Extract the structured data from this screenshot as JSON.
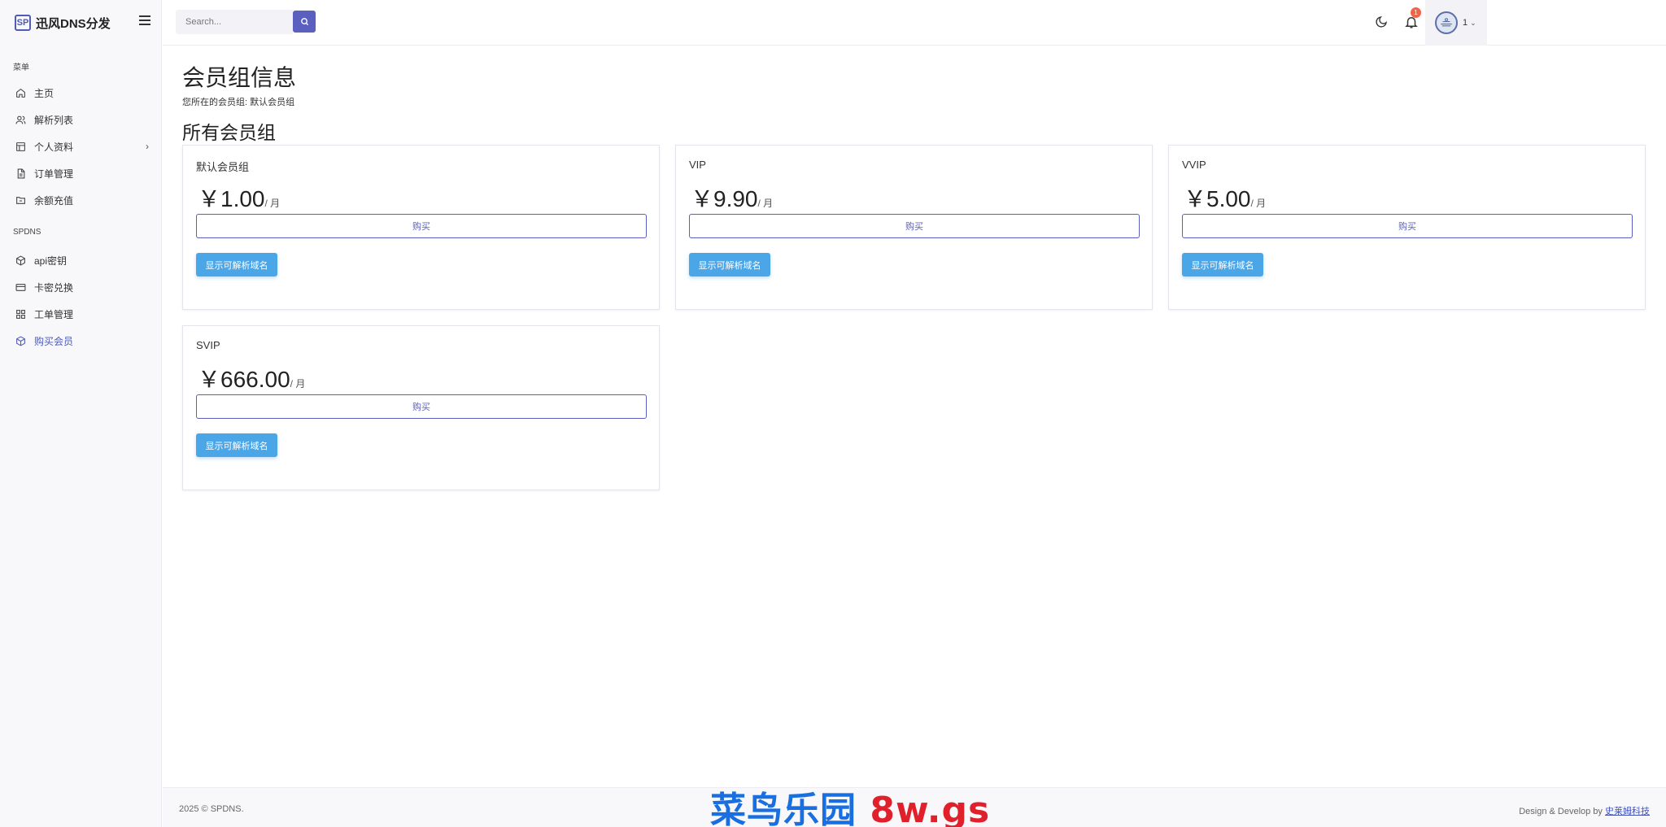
{
  "brand": {
    "logo": "SP",
    "name": "迅风DNS分发"
  },
  "sidebar": {
    "sections": [
      {
        "label": "菜单"
      },
      {
        "label": "SPDNS"
      }
    ],
    "items": [
      {
        "label": "主页",
        "icon": "home-icon"
      },
      {
        "label": "解析列表",
        "icon": "users-icon"
      },
      {
        "label": "个人资料",
        "icon": "layout-icon"
      },
      {
        "label": "订单管理",
        "icon": "file-icon"
      },
      {
        "label": "余额充值",
        "icon": "folder-icon"
      },
      {
        "label": "api密钥",
        "icon": "cube-icon"
      },
      {
        "label": "卡密兑换",
        "icon": "card-icon"
      },
      {
        "label": "工单管理",
        "icon": "grid-icon"
      },
      {
        "label": "购买会员",
        "icon": "package-icon"
      }
    ]
  },
  "header": {
    "search_placeholder": "Search...",
    "notification_count": "1",
    "user_name": "1"
  },
  "main": {
    "title": "会员组信息",
    "subtitle": "您所在的会员组: 默认会员组",
    "section_title": "所有会员组",
    "cards": [
      {
        "name": "默认会员组",
        "price": "￥1.00",
        "unit": "/ 月",
        "buy": "购买",
        "show": "显示可解析域名"
      },
      {
        "name": "VIP",
        "price": "￥9.90",
        "unit": "/ 月",
        "buy": "购买",
        "show": "显示可解析域名"
      },
      {
        "name": "VVIP",
        "price": "￥5.00",
        "unit": "/ 月",
        "buy": "购买",
        "show": "显示可解析域名"
      },
      {
        "name": "SVIP",
        "price": "￥666.00",
        "unit": "/ 月",
        "buy": "购买",
        "show": "显示可解析域名"
      }
    ]
  },
  "footer": {
    "copyright": "2025 © SPDNS.",
    "credit_prefix": "Design & Develop by",
    "credit_link": "史莱姆科技"
  },
  "watermark": {
    "cn": "菜鸟乐园",
    "en": "8w.gs"
  },
  "colors": {
    "accent": "#5a5fc0",
    "info": "#4ba6e8",
    "badge": "#f06548"
  }
}
